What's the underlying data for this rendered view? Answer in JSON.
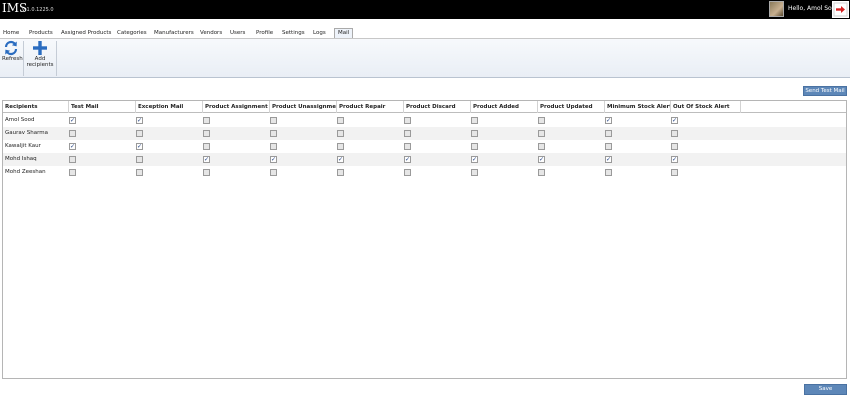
{
  "app": {
    "title": "IMS",
    "version": "v 1.0.1225.0",
    "greeting": "Hello, Amol Sood"
  },
  "tabs": [
    {
      "label": "Home",
      "active": false
    },
    {
      "label": "Products",
      "active": false
    },
    {
      "label": "Assigned Products",
      "active": false
    },
    {
      "label": "Categories",
      "active": false
    },
    {
      "label": "Manufacturers",
      "active": false
    },
    {
      "label": "Vendors",
      "active": false
    },
    {
      "label": "Users",
      "active": false
    },
    {
      "label": "Profile",
      "active": false
    },
    {
      "label": "Settings",
      "active": false
    },
    {
      "label": "Logs",
      "active": false
    },
    {
      "label": "Mail",
      "active": true
    }
  ],
  "ribbon": {
    "refresh_label": "Refresh",
    "add_recipients_label": "Add recipients"
  },
  "send_test_mail_label": "Send Test Mail",
  "save_label": "Save",
  "grid": {
    "columns": [
      "Recipients",
      "Test Mail",
      "Exception Mail",
      "Product Assignment",
      "Product Unassignment",
      "Product Repair",
      "Product Discard",
      "Product Added",
      "Product Updated",
      "Minimum Stock Alert",
      "Out Of Stock Alert"
    ],
    "rows": [
      {
        "name": "Amol Sood",
        "checks": [
          true,
          true,
          false,
          false,
          false,
          false,
          false,
          false,
          true,
          true
        ]
      },
      {
        "name": "Gaurav Sharma",
        "checks": [
          false,
          false,
          false,
          false,
          false,
          false,
          false,
          false,
          false,
          false
        ]
      },
      {
        "name": "Kawaljit Kaur",
        "checks": [
          true,
          true,
          false,
          false,
          false,
          false,
          false,
          false,
          false,
          false
        ]
      },
      {
        "name": "Mohd Ishaq",
        "checks": [
          false,
          false,
          true,
          true,
          true,
          true,
          true,
          true,
          true,
          true
        ]
      },
      {
        "name": "Mohd Zeeshan",
        "checks": [
          false,
          false,
          false,
          false,
          false,
          false,
          false,
          false,
          false,
          false
        ]
      }
    ]
  }
}
